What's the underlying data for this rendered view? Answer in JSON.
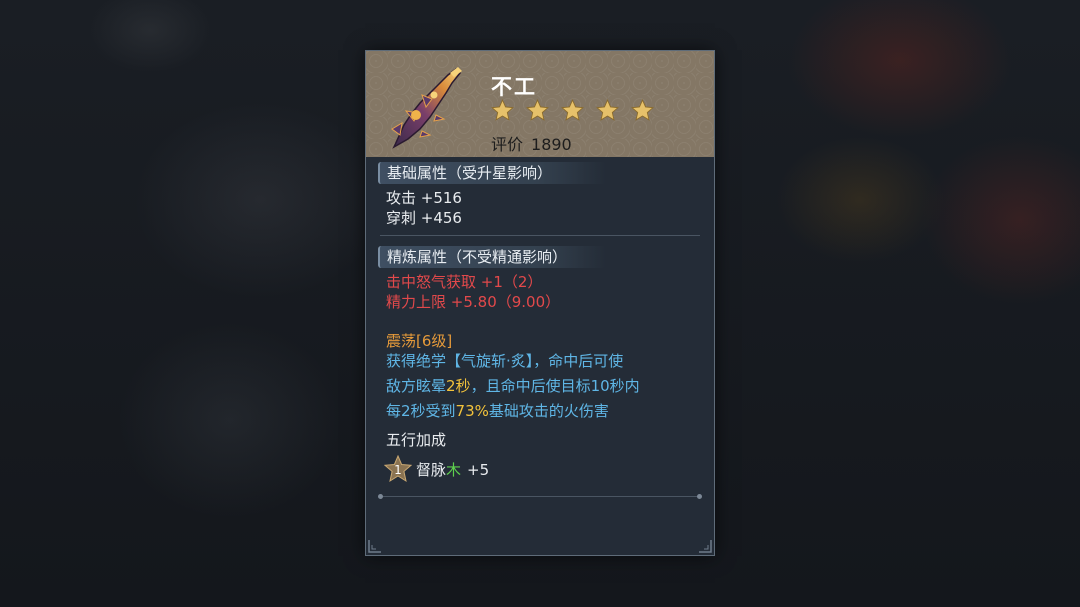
{
  "item": {
    "name": "不工",
    "star_count": 5,
    "rating_label": "评价",
    "rating_value": "1890"
  },
  "base_section": {
    "title": "基础属性（受升星影响）",
    "stats": [
      "攻击 +516",
      "穿刺 +456"
    ]
  },
  "refine_section": {
    "title": "精炼属性（不受精通影响）",
    "stats": [
      "击中怒气获取 +1（2）",
      "精力上限 +5.80（9.00）"
    ]
  },
  "skill": {
    "name": "震荡[6级]",
    "line1": "获得绝学【气旋斩·炙】，命中后可使",
    "line2_a": "敌方眩晕",
    "line2_b": "2秒",
    "line2_c": "，且命中后使目标10秒内",
    "line3_a": "每2秒受到",
    "line3_b": "73%",
    "line3_c": "基础攻击的火伤害"
  },
  "wuxing": {
    "title": "五行加成",
    "badge_number": "1",
    "meridian": "督脉",
    "element": "木",
    "bonus": "+5"
  },
  "colors": {
    "header_bg": "#847765",
    "panel_bg": "#242c37",
    "refine_red": "#e2494b",
    "skill_orange": "#e59a3a",
    "desc_blue": "#5fb6e6",
    "highlight_yellow": "#f2c23b",
    "element_green": "#5ed04e",
    "star_gold": "#e6c16a"
  },
  "icons": [
    "weapon-icon",
    "star-icon",
    "wuxing-star-badge-icon",
    "corner-ornament-icon"
  ]
}
